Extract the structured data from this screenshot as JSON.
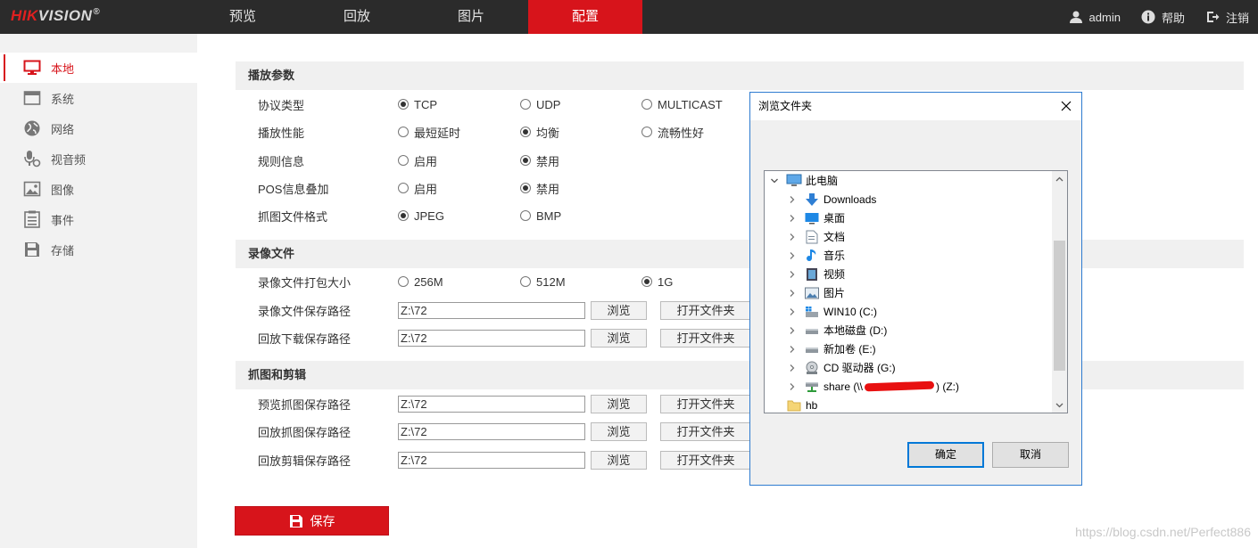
{
  "brand": {
    "logo_red": "HIK",
    "logo_rest": "VISION",
    "logo_mark": "®"
  },
  "nav": [
    {
      "label": "预览"
    },
    {
      "label": "回放"
    },
    {
      "label": "图片"
    },
    {
      "label": "配置"
    }
  ],
  "top_right": {
    "user": "admin",
    "help": "帮助",
    "logout": "注销"
  },
  "sidebar": [
    {
      "label": "本地",
      "icon": "monitor-icon"
    },
    {
      "label": "系统",
      "icon": "window-icon"
    },
    {
      "label": "网络",
      "icon": "globe-icon"
    },
    {
      "label": "视音频",
      "icon": "mic-camera-icon"
    },
    {
      "label": "图像",
      "icon": "image-icon"
    },
    {
      "label": "事件",
      "icon": "list-icon"
    },
    {
      "label": "存储",
      "icon": "disk-icon"
    }
  ],
  "playback": {
    "title": "播放参数",
    "protocol": {
      "label": "协议类型",
      "options": [
        "TCP",
        "UDP",
        "MULTICAST"
      ],
      "selected": "TCP"
    },
    "performance": {
      "label": "播放性能",
      "options": [
        "最短延时",
        "均衡",
        "流畅性好"
      ],
      "selected": "均衡"
    },
    "rules": {
      "label": "规则信息",
      "options": [
        "启用",
        "禁用"
      ],
      "selected": "禁用"
    },
    "pos": {
      "label": "POS信息叠加",
      "options": [
        "启用",
        "禁用"
      ],
      "selected": "禁用"
    },
    "snapshot_format": {
      "label": "抓图文件格式",
      "options": [
        "JPEG",
        "BMP"
      ],
      "selected": "JPEG"
    }
  },
  "record": {
    "title": "录像文件",
    "pack_size": {
      "label": "录像文件打包大小",
      "options": [
        "256M",
        "512M",
        "1G"
      ],
      "selected": "1G"
    },
    "save_path": {
      "label": "录像文件保存路径",
      "value": "Z:\\72"
    },
    "download_path": {
      "label": "回放下载保存路径",
      "value": "Z:\\72"
    }
  },
  "capture": {
    "title": "抓图和剪辑",
    "preview_path": {
      "label": "预览抓图保存路径",
      "value": "Z:\\72"
    },
    "playback_path": {
      "label": "回放抓图保存路径",
      "value": "Z:\\72"
    },
    "clip_path": {
      "label": "回放剪辑保存路径",
      "value": "Z:\\72"
    }
  },
  "buttons": {
    "browse": "浏览",
    "open_folder": "打开文件夹",
    "save": "保存"
  },
  "dialog": {
    "title": "浏览文件夹",
    "tree": [
      {
        "label": "此电脑",
        "icon": "computer-icon",
        "expanded": true,
        "level": 0
      },
      {
        "label": "Downloads",
        "icon": "download-icon",
        "level": 1
      },
      {
        "label": "桌面",
        "icon": "desktop-icon",
        "level": 1
      },
      {
        "label": "文档",
        "icon": "document-icon",
        "level": 1
      },
      {
        "label": "音乐",
        "icon": "music-icon",
        "level": 1
      },
      {
        "label": "视频",
        "icon": "video-icon",
        "level": 1
      },
      {
        "label": "图片",
        "icon": "picture-icon",
        "level": 1
      },
      {
        "label": "WIN10 (C:)",
        "icon": "windows-drive-icon",
        "level": 1
      },
      {
        "label": "本地磁盘 (D:)",
        "icon": "drive-icon",
        "level": 1
      },
      {
        "label": "新加卷 (E:)",
        "icon": "drive-icon",
        "level": 1
      },
      {
        "label": "CD 驱动器 (G:)",
        "icon": "cd-drive-icon",
        "level": 1
      },
      {
        "label_prefix": "share (\\\\",
        "label_suffix": ") (Z:)",
        "icon": "network-drive-icon",
        "level": 1
      },
      {
        "label": "hb",
        "icon": "folder-icon",
        "level": 0
      }
    ],
    "ok": "确定",
    "cancel": "取消"
  },
  "watermark": "https://blog.csdn.net/Perfect886",
  "colors": {
    "accent": "#d7141b",
    "topbar": "#2b2b2b",
    "sidebar": "#f2f2f2",
    "dialog_border": "#2d7bd0"
  }
}
